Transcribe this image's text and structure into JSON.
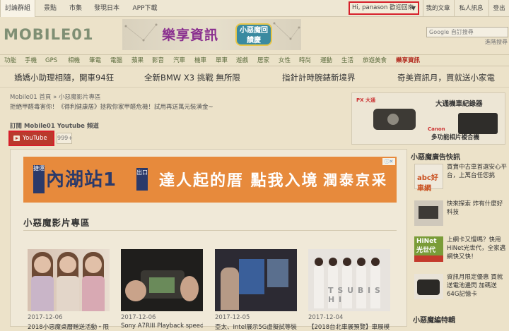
{
  "topbar": {
    "tabs": [
      "討論群組",
      "景點",
      "市集",
      "發現日本",
      "APP下載"
    ],
    "user_greeting": "Hi, panason 歡迎回來",
    "right_tabs": [
      "我的文章",
      "私人訊息",
      "登出"
    ]
  },
  "header": {
    "logo": "MOBILE01",
    "banner_title": "樂享資訊",
    "banner_badge": "小惡魔回饋慶",
    "search_placeholder": "Google 自訂搜尋",
    "advanced_search": "進階搜尋"
  },
  "category_nav": [
    "功能",
    "手機",
    "GPS",
    "相機",
    "筆電",
    "電腦",
    "蘋果",
    "影音",
    "汽車",
    "機車",
    "單車",
    "遊戲",
    "居家",
    "女性",
    "時尚",
    "運動",
    "生活",
    "旅遊美食",
    "樂享資訊"
  ],
  "headlines": [
    "嬌嬌小助理相隨，開車94狂",
    "全新BMW X3 挑戰 無所限",
    "指針計時腕錶新境界",
    "奇美資訊月，買就送小家電"
  ],
  "breadcrumb": {
    "home": "Mobile01 首頁",
    "sep": "»",
    "current": "小惡魔影片專區"
  },
  "notice": "拒絕甲醛毒害你！《得利健康居》拯救你家甲醛危機！試用再送萬元裝潢金~",
  "subscribe": {
    "title": "訂閱 Mobile01 Youtube 頻道",
    "button": "YouTube",
    "count": "999+"
  },
  "right_banner": {
    "brand_left": "PX 大通",
    "title_left": "大通機車紀錄器",
    "brand_right": "Canon",
    "title_right": "多功能相片複合機"
  },
  "ad": {
    "stamp": "捷運",
    "station": "內湖站1",
    "exit": "出口",
    "slogan": "達人起的厝 點我入境",
    "brand": "潤泰京采",
    "ad_mark": "ⓘ✕"
  },
  "section": {
    "title": "小惡魔影片專區"
  },
  "videos": [
    {
      "date": "2017-12-06",
      "title": "2018小惡魔桌曆贈送活動・限"
    },
    {
      "date": "2017-12-06",
      "title": "Sony A7RIII Playback speed"
    },
    {
      "date": "2017-12-05",
      "title": "亞太、Intel展示5G虛擬試等裝"
    },
    {
      "date": "2017-12-04",
      "title": "【2018台北車展預覽】車展模"
    }
  ],
  "video_watermark": "T S U B I S H I",
  "sidebar": {
    "ads_title": "小惡魔廣告快訊",
    "ads": [
      {
        "thumb": "abc好車網",
        "text": "買賣中古車首選安心平台，上萬台任您挑"
      },
      {
        "thumb": "laptop",
        "text": "快來探索 炸有什麼好科技"
      },
      {
        "thumb": "HiNet 光世代",
        "text": "上網卡又慢嗎？快用HiNet光世代，全家邁網快又快！"
      },
      {
        "thumb": "camera",
        "text": "資訊月限定優惠 買就送電池邊閃 加碼送64G記憶卡"
      }
    ],
    "blog_title": "小惡魔編特輯"
  }
}
